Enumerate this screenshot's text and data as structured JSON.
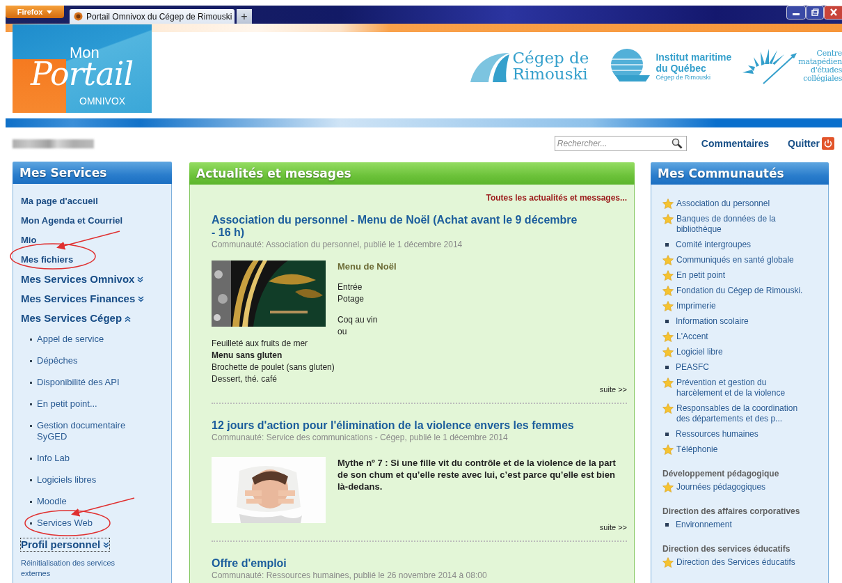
{
  "browser": {
    "menu_button": "Firefox",
    "tabs": [
      {
        "title": "Portail Omnivox du Cégep de Rimouski",
        "selected": true
      }
    ],
    "new_tab": "+"
  },
  "header": {
    "portal_logo": {
      "top": "Mon",
      "main": "Portail",
      "bottom": "OMNIVOX"
    },
    "partner_logos": [
      {
        "kind": "cegep",
        "lines": [
          "Cégep de",
          "Rimouski"
        ]
      },
      {
        "kind": "institute",
        "lines": [
          "Institut maritime",
          "du Québec"
        ],
        "subtitle": "Cégep de Rimouski"
      },
      {
        "kind": "centre",
        "lines": [
          "Centre",
          "matapédien",
          "d'études",
          "collégiales"
        ]
      }
    ]
  },
  "toolbar": {
    "search": {
      "placeholder": "Rechercher..."
    },
    "links": [
      {
        "label": "Commentaires",
        "kind": "link"
      },
      {
        "label": "Quitter",
        "kind": "quit"
      }
    ]
  },
  "services": {
    "title": "Mes Services",
    "items": [
      {
        "kind": "link",
        "label": "Ma page d'accueil",
        "annotated": false
      },
      {
        "kind": "link",
        "label": "Mon Agenda et Courriel",
        "annotated": false
      },
      {
        "kind": "link",
        "label": "Mio",
        "annotated": false
      },
      {
        "kind": "link",
        "label": "Mes fichiers",
        "annotated": true
      },
      {
        "kind": "section",
        "label": "Mes Services Omnivox",
        "expanded": false,
        "focused": false
      },
      {
        "kind": "section",
        "label": "Mes Services Finances",
        "expanded": false,
        "focused": false
      },
      {
        "kind": "section",
        "label": "Mes Services Cégep",
        "expanded": true,
        "focused": false,
        "children": [
          {
            "label": "Appel de service",
            "annotated": false
          },
          {
            "label": "Dépêches",
            "annotated": false
          },
          {
            "label": "Disponibilité des API",
            "annotated": false
          },
          {
            "label": "En petit point...",
            "annotated": false
          },
          {
            "label": "Gestion documentaire SyGED",
            "annotated": false
          },
          {
            "label": "Info Lab",
            "annotated": false
          },
          {
            "label": "Logiciels libres",
            "annotated": false
          },
          {
            "label": "Moodle",
            "annotated": false
          },
          {
            "label": "Services Web",
            "annotated": true
          }
        ]
      },
      {
        "kind": "section",
        "label": "Profil personnel",
        "expanded": false,
        "focused": true
      },
      {
        "kind": "note",
        "label": "Réinitialisation des services externes"
      }
    ]
  },
  "news": {
    "title": "Actualités et messages",
    "all_link": "Toutes les actualités et messages...",
    "posts": [
      {
        "title": "Association du personnel - Menu de Noël (Achat avant le 9 décembre - 16 h)",
        "meta": "Communauté: Association du personnel,  publié le 1 décembre 2014",
        "picture": {
          "kind": "picture"
        },
        "body": [
          {
            "kind": "heading",
            "text": "Menu de Noël"
          },
          {
            "kind": "gap"
          },
          {
            "kind": "plain",
            "text": "Entrée"
          },
          {
            "kind": "plain",
            "text": "Potage"
          },
          {
            "kind": "gap"
          },
          {
            "kind": "plain",
            "text": "Coq au vin"
          },
          {
            "kind": "plain",
            "text": "ou"
          },
          {
            "kind": "plain",
            "text": "Feuilleté aux fruits de mer"
          },
          {
            "kind": "bold",
            "text": "Menu sans gluten"
          },
          {
            "kind": "plain",
            "text": "Brochette de poulet (sans gluten)"
          },
          {
            "kind": "plain",
            "text": "Dessert, thé. café"
          }
        ],
        "more": "suite >>"
      },
      {
        "title": "12 jours d'action pour l'élimination de la violence envers les femmes",
        "meta": "Communauté: Service des communications - Cégep,  publié le 1 décembre 2014",
        "picture": {
          "kind": "picture"
        },
        "body": [
          {
            "kind": "bold",
            "text": "Mythe nº 7 : Si une fille vit du contrôle et de la violence de la part de son chum et qu’elle reste avec lui, c’est parce qu’elle est bien là-dedans."
          }
        ],
        "more": "suite >>"
      },
      {
        "title": "Offre d'emploi",
        "meta": "Communauté: Ressources humaines,  publié le 26 novembre 2014 à 08:00"
      }
    ]
  },
  "communities": {
    "title": "Mes Communautés",
    "groups": [
      {
        "items": [
          {
            "label": "Association du personnel",
            "favorite": true
          },
          {
            "label": "Banques de données de la bibliothèque",
            "favorite": true
          },
          {
            "label": "Comité intergroupes",
            "favorite": false
          },
          {
            "label": "Communiqués en santé globale",
            "favorite": true
          },
          {
            "label": "En petit point",
            "favorite": true
          },
          {
            "label": "Fondation du Cégep de Rimouski.",
            "favorite": true
          },
          {
            "label": "Imprimerie",
            "favorite": true
          },
          {
            "label": "Information scolaire",
            "favorite": false
          },
          {
            "label": "L'Accent",
            "favorite": true
          },
          {
            "label": "Logiciel libre",
            "favorite": true
          },
          {
            "label": "PEASFC",
            "favorite": false
          },
          {
            "label": "Prévention et gestion du harcèlement et de la violence",
            "favorite": true
          },
          {
            "label": "Responsables de la coordination des départements et des p...",
            "favorite": true
          },
          {
            "label": "Ressources humaines",
            "favorite": false
          },
          {
            "label": "Téléphonie",
            "favorite": true
          }
        ]
      },
      {
        "title": "Développement pédagogique",
        "items": [
          {
            "label": "Journées pédagogiques",
            "favorite": true
          }
        ]
      },
      {
        "title": "Direction des affaires corporatives",
        "items": [
          {
            "label": "Environnement",
            "favorite": false
          }
        ]
      },
      {
        "title": "Direction des services éducatifs",
        "items": [
          {
            "label": "Direction des Services éducatifs",
            "favorite": true
          }
        ]
      }
    ]
  }
}
